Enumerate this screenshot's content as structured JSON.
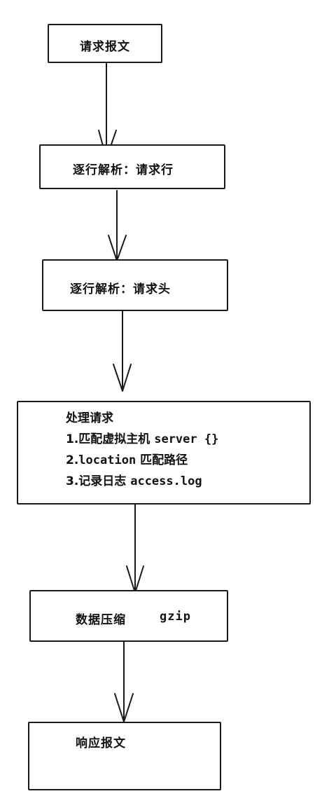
{
  "nodes": {
    "request_message": {
      "label": "请求报文"
    },
    "parse_request_line": {
      "label": "逐行解析：请求行"
    },
    "parse_request_headers": {
      "label": "逐行解析：请求头"
    },
    "process_request": {
      "title": "处理请求",
      "steps": [
        {
          "prefix": "1.匹配虚拟主机 ",
          "code": "server {}"
        },
        {
          "prefix": "2.",
          "code": "location",
          "suffix": " 匹配路径"
        },
        {
          "prefix": "3.记录日志  ",
          "code": "access.log"
        }
      ]
    },
    "compress": {
      "label": "数据压缩",
      "code": "gzip"
    },
    "response_message": {
      "label": "响应报文"
    }
  }
}
